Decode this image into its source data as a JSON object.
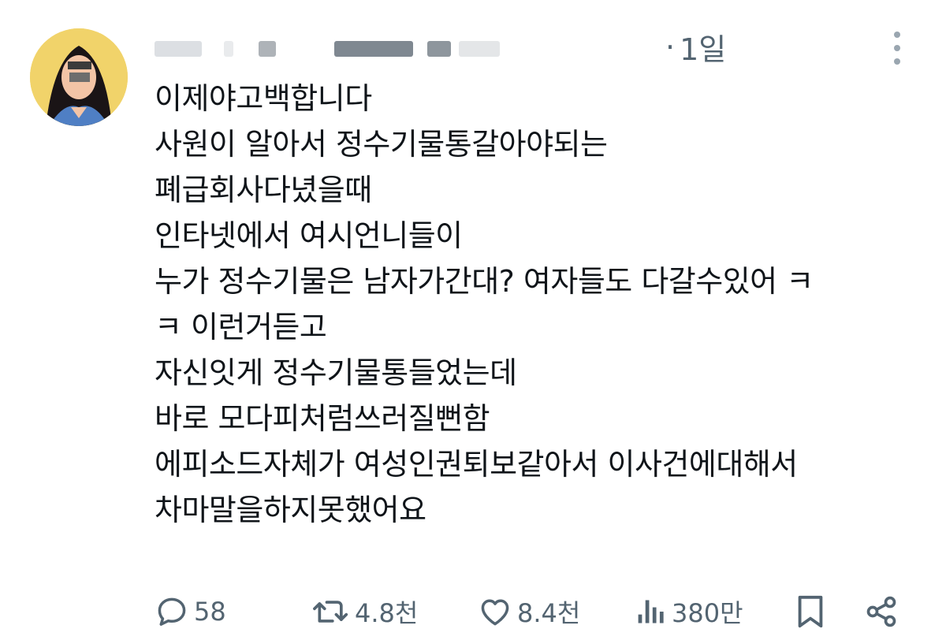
{
  "tweet": {
    "timestamp": "1일",
    "separator": "·",
    "lines": [
      "이제야고백합니다",
      "사원이 알아서 정수기물통갈아야되는",
      "폐급회사다녔을때",
      "인타넷에서 여시언니들이",
      "누가 정수기물은 남자가간대? 여자들도 다갈수있어 ㅋ",
      "ㅋ 이런거듣고",
      "자신잇게 정수기물통들었는데",
      "바로 모다피처럼쓰러질뻔함",
      "에피소드자체가 여성인권퇴보같아서 이사건에대해서",
      "차마말을하지못했어요"
    ]
  },
  "actions": {
    "replies": "58",
    "retweets": "4.8천",
    "likes": "8.4천",
    "views": "380만"
  },
  "colors": {
    "text": "#0f1419",
    "secondary": "#536471",
    "avatar_bg": "#f1d36a"
  },
  "icons": [
    "reply-icon",
    "retweet-icon",
    "like-icon",
    "views-icon",
    "bookmark-icon",
    "share-icon",
    "more-icon"
  ]
}
